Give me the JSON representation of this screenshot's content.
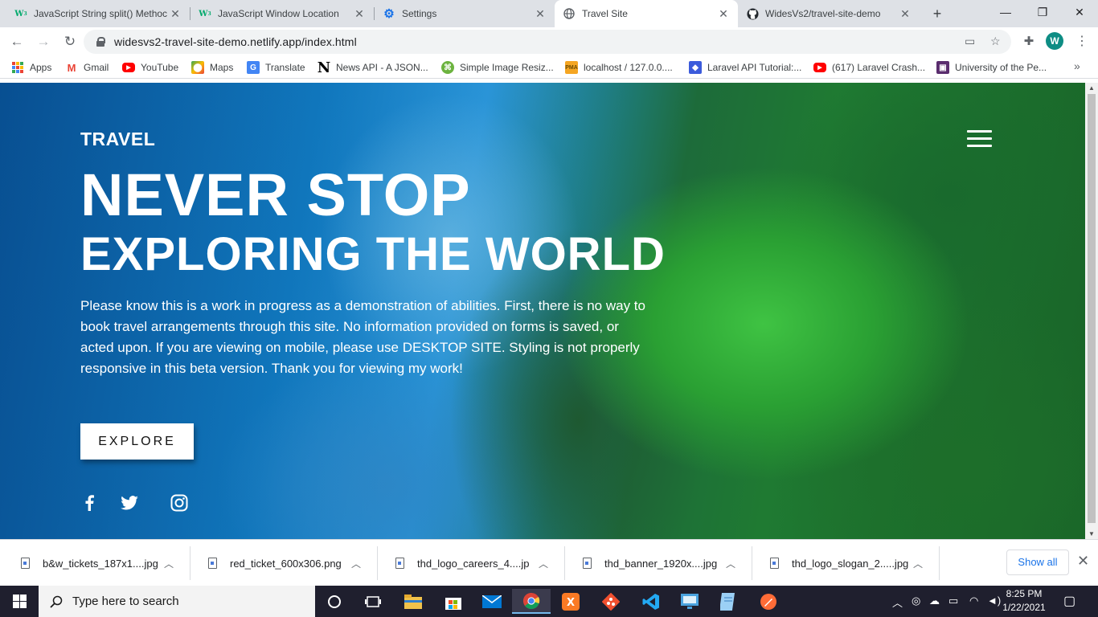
{
  "browser": {
    "tabs": [
      {
        "title": "JavaScript String split() Methoc",
        "favicon": "w3schools-icon",
        "active": false
      },
      {
        "title": "JavaScript Window Location",
        "favicon": "w3schools-icon",
        "active": false
      },
      {
        "title": "Settings",
        "favicon": "gear-icon",
        "active": false
      },
      {
        "title": "Travel Site",
        "favicon": "globe-icon",
        "active": true
      },
      {
        "title": "WidesVs2/travel-site-demo",
        "favicon": "github-icon",
        "active": false
      }
    ],
    "url": "widesvs2-travel-site-demo.netlify.app/index.html",
    "profile_initial": "W",
    "bookmarks": [
      {
        "label": "Apps",
        "icon": "apps-grid-icon"
      },
      {
        "label": "Gmail",
        "icon": "gmail-icon"
      },
      {
        "label": "YouTube",
        "icon": "youtube-icon"
      },
      {
        "label": "Maps",
        "icon": "maps-icon"
      },
      {
        "label": "Translate",
        "icon": "translate-icon"
      },
      {
        "label": "News API - A JSON...",
        "icon": "news-n-icon"
      },
      {
        "label": "Simple Image Resiz...",
        "icon": "image-resizer-icon"
      },
      {
        "label": "localhost / 127.0.0....",
        "icon": "phpmyadmin-icon"
      },
      {
        "label": "Laravel API Tutorial:...",
        "icon": "laravel-icon"
      },
      {
        "label": "(617) Laravel Crash...",
        "icon": "youtube-icon"
      },
      {
        "label": "University of the Pe...",
        "icon": "university-icon"
      }
    ]
  },
  "page": {
    "brand": "TRAVEL",
    "headline_1": "NEVER STOP",
    "headline_2": "EXPLORING THE WORLD",
    "description": "Please know this is a work in progress as a demonstration of abilities. First, there is no way to book travel arrangements through this site. No information provided on forms is saved, or acted upon. If you are viewing on mobile, please use DESKTOP SITE. Styling is not properly responsive in this beta version. Thank you for viewing my work!",
    "cta_label": "EXPLORE",
    "social": [
      "facebook-icon",
      "twitter-icon",
      "instagram-icon"
    ]
  },
  "downloads": {
    "items": [
      "b&w_tickets_187x1....jpg",
      "red_ticket_600x306.png",
      "thd_logo_careers_4....jp",
      "thd_banner_1920x....jpg",
      "thd_logo_slogan_2.....jpg"
    ],
    "show_all": "Show all"
  },
  "taskbar": {
    "search_placeholder": "Type here to search",
    "time": "8:25 PM",
    "date": "1/22/2021"
  },
  "colors": {
    "accent": "#1a73e8",
    "avatar": "#0e8d84",
    "taskbar": "#1f1f2e"
  }
}
